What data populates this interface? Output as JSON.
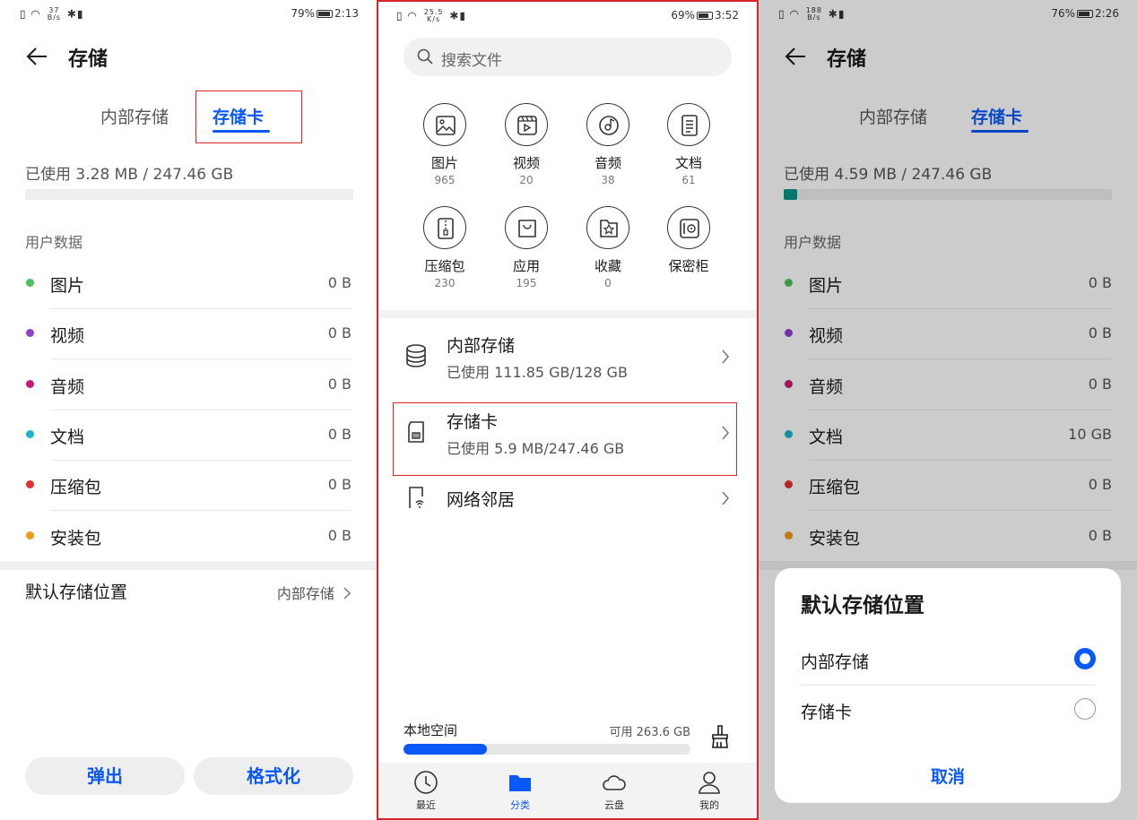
{
  "colors": {
    "accent": "#0a59f7",
    "highlight": "#d7262b",
    "teal": "#00978a",
    "pictures": "#4cc15c",
    "videos": "#8f3fd0",
    "audio": "#c8197a",
    "docs": "#17b7c9",
    "archives": "#e3312f",
    "apks": "#ef9a17"
  },
  "left": {
    "status": {
      "net": "37",
      "net_unit": "B/s",
      "battery": "79%",
      "time": "2:13"
    },
    "title": "存储",
    "tabs": [
      "内部存储",
      "存储卡"
    ],
    "used": "已使用 3.28 MB / 247.46 GB",
    "bar_fraction": 0.0,
    "section": "用户数据",
    "rows": [
      {
        "label": "图片",
        "value": "0 B"
      },
      {
        "label": "视频",
        "value": "0 B"
      },
      {
        "label": "音频",
        "value": "0 B"
      },
      {
        "label": "文档",
        "value": "0 B"
      },
      {
        "label": "压缩包",
        "value": "0 B"
      },
      {
        "label": "安装包",
        "value": "0 B"
      }
    ],
    "default_label": "默认存储位置",
    "default_value": "内部存储",
    "eject": "弹出",
    "format": "格式化"
  },
  "middle": {
    "status": {
      "net": "25.5",
      "net_unit": "K/s",
      "battery": "69%",
      "time": "3:52"
    },
    "search_placeholder": "搜索文件",
    "categories": [
      {
        "name": "图片",
        "count": "965",
        "icon": "image-icon"
      },
      {
        "name": "视频",
        "count": "20",
        "icon": "video-icon"
      },
      {
        "name": "音频",
        "count": "38",
        "icon": "music-icon"
      },
      {
        "name": "文档",
        "count": "61",
        "icon": "document-icon"
      },
      {
        "name": "压缩包",
        "count": "230",
        "icon": "archive-icon"
      },
      {
        "name": "应用",
        "count": "195",
        "icon": "bag-icon"
      },
      {
        "name": "收藏",
        "count": "0",
        "icon": "star-icon"
      },
      {
        "name": "保密柜",
        "icon": "safe-icon"
      }
    ],
    "storage": [
      {
        "title": "内部存储",
        "sub": "已使用 111.85 GB/128 GB",
        "icon": "database-icon"
      },
      {
        "title": "存储卡",
        "sub": "已使用 5.9 MB/247.46 GB",
        "icon": "sdcard-icon"
      },
      {
        "title": "网络邻居",
        "icon": "network-icon"
      }
    ],
    "local_label": "本地空间",
    "local_avail": "可用 263.6 GB",
    "local_fraction": 0.29,
    "nav": [
      {
        "label": "最近",
        "icon": "clock-icon"
      },
      {
        "label": "分类",
        "icon": "folder-icon"
      },
      {
        "label": "云盘",
        "icon": "cloud-icon"
      },
      {
        "label": "我的",
        "icon": "person-icon"
      }
    ]
  },
  "right": {
    "status": {
      "net": "188",
      "net_unit": "B/s",
      "battery": "76%",
      "time": "2:26"
    },
    "title": "存储",
    "tabs": [
      "内部存储",
      "存储卡"
    ],
    "used": "已使用 4.59 MB / 247.46 GB",
    "bar_fraction": 0.04,
    "section": "用户数据",
    "rows": [
      {
        "label": "图片",
        "value": "0 B"
      },
      {
        "label": "视频",
        "value": "0 B"
      },
      {
        "label": "音频",
        "value": "0 B"
      },
      {
        "label": "文档",
        "value": "10 GB"
      },
      {
        "label": "压缩包",
        "value": "0 B"
      },
      {
        "label": "安装包",
        "value": "0 B"
      }
    ],
    "dialog": {
      "title": "默认存储位置",
      "options": [
        "内部存储",
        "存储卡"
      ],
      "selected": 0,
      "cancel": "取消"
    }
  }
}
